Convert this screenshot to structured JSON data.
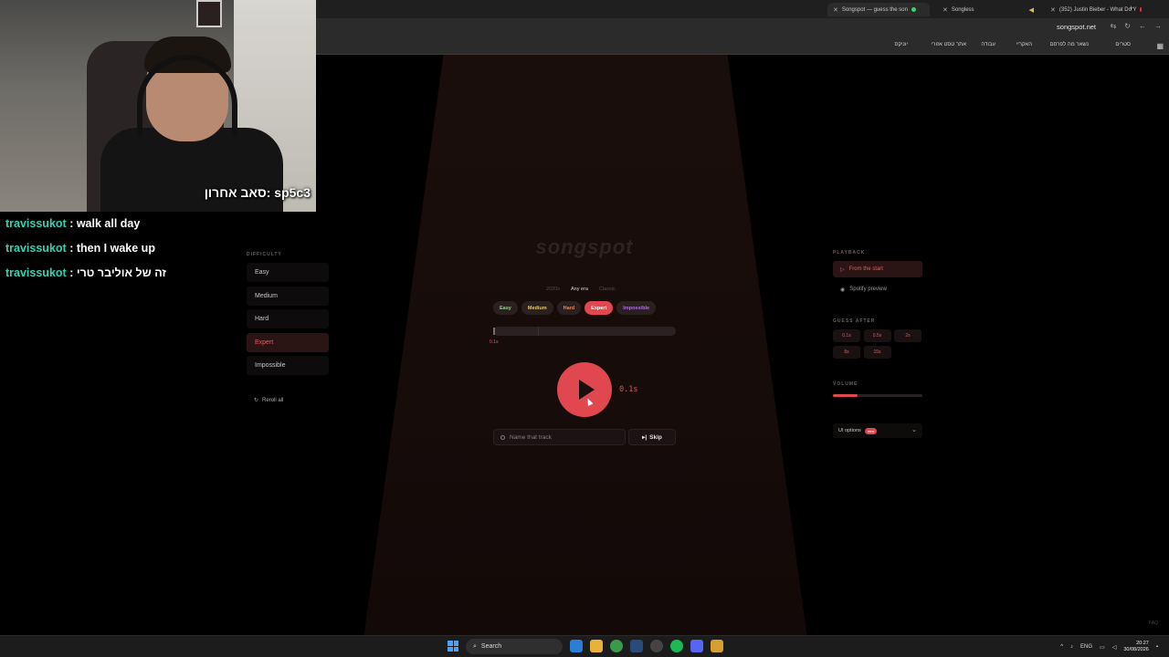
{
  "browser": {
    "tabs": [
      {
        "title": "Songspot — guess the son",
        "active": true
      },
      {
        "title": "Songless",
        "active": false
      },
      {
        "title": "(352) Justin Bieber - What Do Y",
        "active": false
      }
    ],
    "new_tab": "+",
    "url": "songspot.net",
    "bookmarks": [
      "סטרים",
      "נשאר מה לפרסם",
      "האקריי",
      "עבודה",
      "אתר טסט אזורי",
      "יוניקס"
    ]
  },
  "webcam": {
    "caption": "סאב אחרון: sp5c3"
  },
  "chat": [
    {
      "user": "travissukot",
      "message": ": walk all day"
    },
    {
      "user": "travissukot",
      "message": ": then I wake up"
    },
    {
      "user": "travissukot",
      "message": ": זה של אוליבר טרי"
    }
  ],
  "game": {
    "logo": "songspot",
    "eras": [
      "2020s",
      "Any era",
      "Classic"
    ],
    "selected_era": "Any era",
    "difficulty_pills": [
      "Easy",
      "Medium",
      "Hard",
      "Expert",
      "Impossible"
    ],
    "selected_difficulty": "Expert",
    "progress_label": "0.1s",
    "play_time": "0.1s",
    "search_placeholder": "Name that track",
    "skip_label": "Skip"
  },
  "left_panel": {
    "title": "DIFFICULTY",
    "items": [
      "Easy",
      "Medium",
      "Hard",
      "Expert",
      "Impossible"
    ],
    "selected": "Expert",
    "reroll_label": "Reroll all"
  },
  "right_panel": {
    "playback_title": "PLAYBACK",
    "playback_options": [
      "From the start",
      "Spotify preview"
    ],
    "playback_selected": "From the start",
    "guess_title": "GUESS AFTER",
    "guess_options": [
      "0.1s",
      "0.5s",
      "2s",
      "8s",
      "15s"
    ],
    "volume_title": "VOLUME",
    "volume_level": 0.28,
    "ui_options_label": "UI options",
    "ui_options_badge": "new",
    "faq": "FAQ"
  },
  "taskbar": {
    "search_label": "Search",
    "language": "ENG",
    "time": "20:27",
    "date": "30/08/2026"
  },
  "colors": {
    "accent": "#e0474f",
    "chat_user": "#2fd3b4",
    "easy": "#8fd48f",
    "medium": "#e8c66a",
    "hard": "#e08c5a",
    "impossible": "#b46be6"
  }
}
